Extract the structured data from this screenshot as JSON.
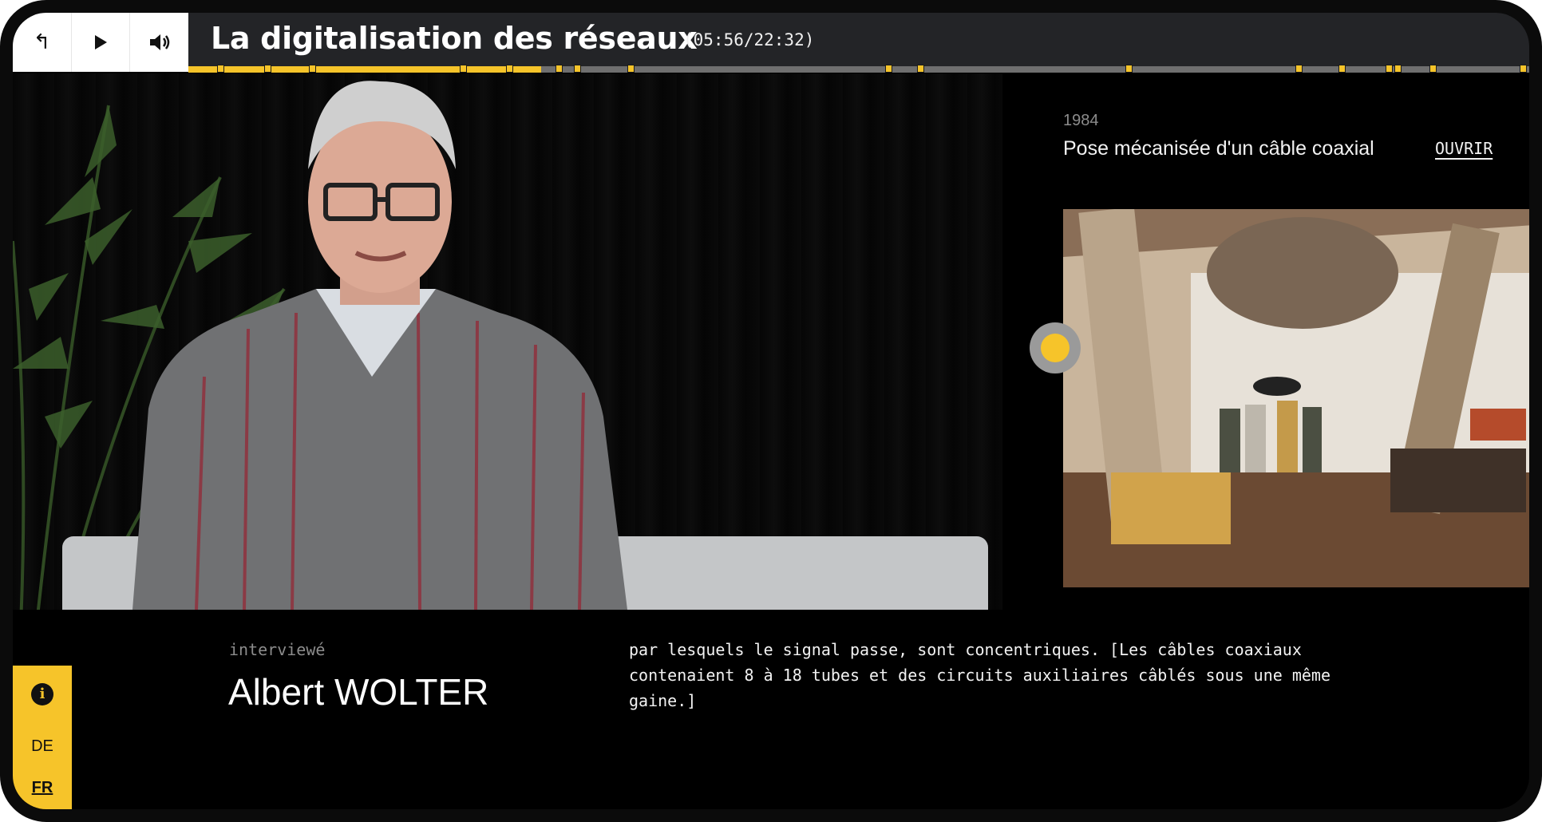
{
  "player": {
    "back_icon": "arrow-back-icon",
    "play_icon": "play-icon",
    "volume_icon": "volume-icon",
    "title": "La digitalisation des réseaux",
    "timecode": "(05:56/22:32)",
    "progress_fraction": 0.263,
    "chapter_marker_fractions": [
      0.024,
      0.059,
      0.092,
      0.205,
      0.239,
      0.276,
      0.29,
      0.33,
      0.522,
      0.546,
      0.701,
      0.828,
      0.86,
      0.895,
      0.902,
      0.928,
      0.995
    ],
    "colors": {
      "accent": "#f6c42a",
      "bar": "#232427",
      "track": "#6f6f6f"
    }
  },
  "media": {
    "year": "1984",
    "title": "Pose mécanisée d'un câble coaxial",
    "open_label": "OUVRIR"
  },
  "speaker": {
    "role": "interviewé",
    "name": "Albert WOLTER"
  },
  "transcript": {
    "text": "par lesquels le signal passe, sont concentriques. [Les câbles coaxiaux\ncontenaient 8 à 18 tubes et des circuits auxiliaires câblés sous une même\ngaine.]"
  },
  "lang": {
    "info_icon": "info-icon",
    "info_glyph": "i",
    "de": "DE",
    "fr": "FR",
    "active": "FR"
  }
}
